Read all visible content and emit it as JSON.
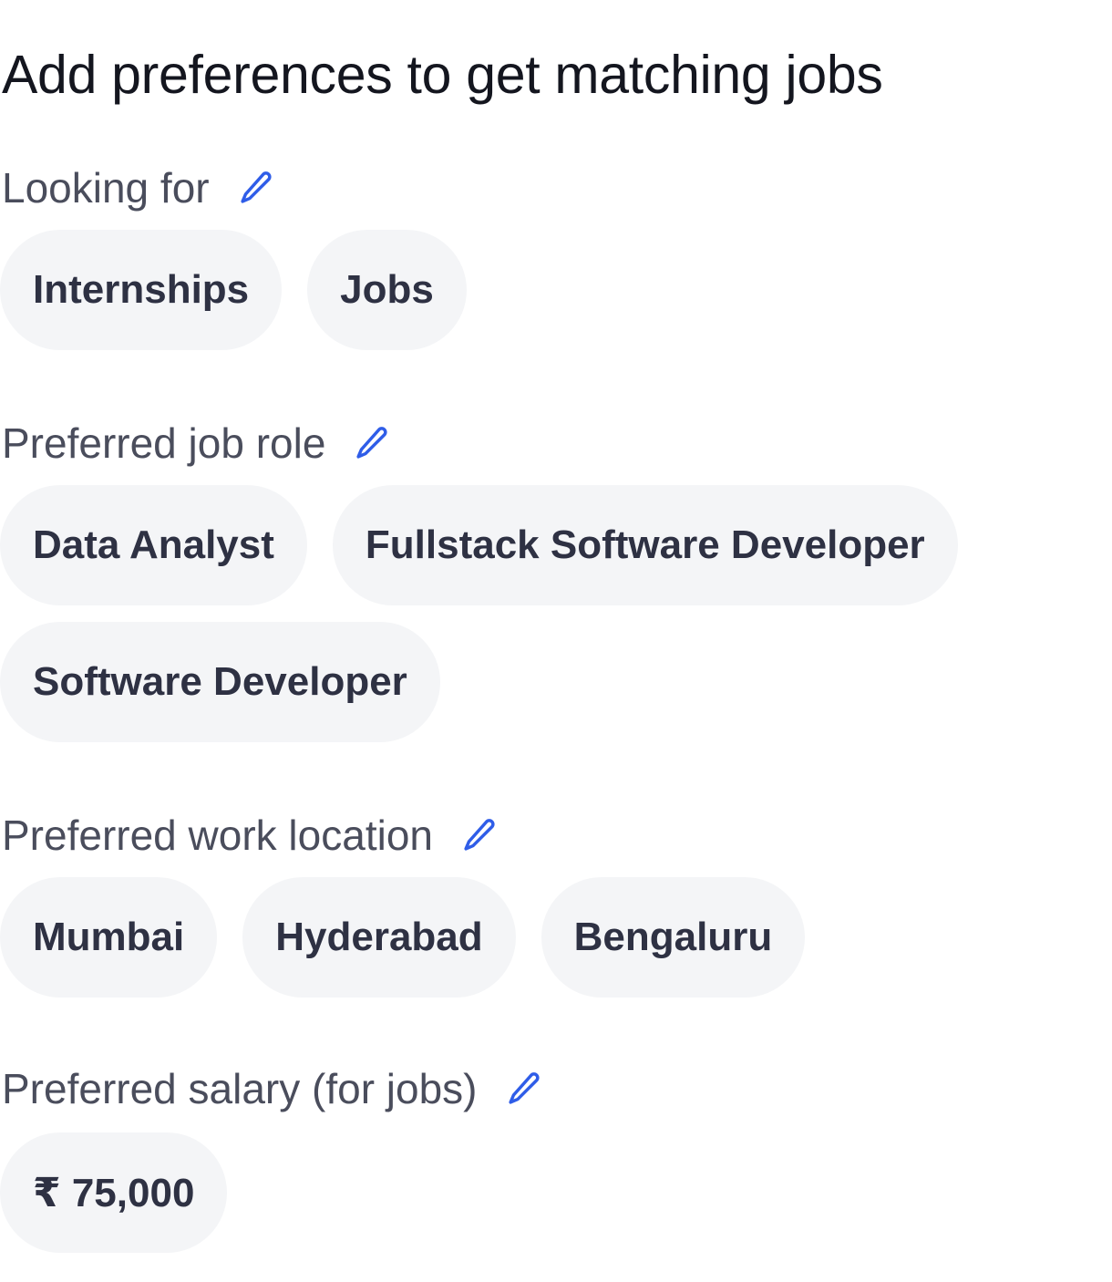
{
  "title": "Add preferences to get matching jobs",
  "accent_color": "#2f5de8",
  "sections": {
    "looking_for": {
      "label": "Looking for",
      "edit_icon": "pencil-icon",
      "chips": [
        "Internships",
        "Jobs"
      ]
    },
    "job_role": {
      "label": "Preferred job role",
      "edit_icon": "pencil-icon",
      "chips": [
        "Data Analyst",
        "Fullstack Software Developer",
        "Software Developer"
      ]
    },
    "work_location": {
      "label": "Preferred work location",
      "edit_icon": "pencil-icon",
      "chips": [
        "Mumbai",
        "Hyderabad",
        "Bengaluru"
      ]
    },
    "salary": {
      "label": "Preferred salary (for jobs)",
      "edit_icon": "pencil-icon",
      "chips": [
        "₹ 75,000"
      ]
    }
  }
}
